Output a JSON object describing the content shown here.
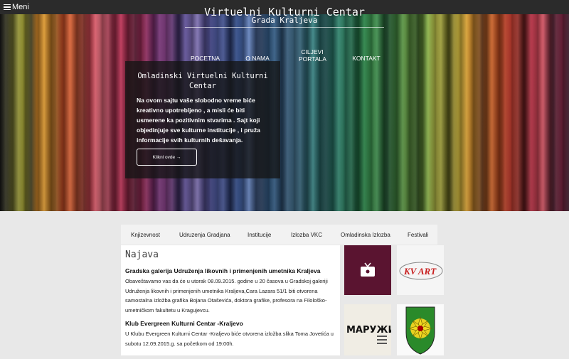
{
  "topbar": {
    "menu_label": "Meni"
  },
  "header": {
    "title": "Virtuelni Kulturni Centar",
    "subtitle": "Grada Kraljeva"
  },
  "nav": {
    "items": [
      {
        "label": "POCETNA"
      },
      {
        "label": "O NAMA"
      },
      {
        "label": "CILJEVI PORTALA"
      },
      {
        "label": "KONTAKT"
      }
    ]
  },
  "hero_panel": {
    "heading": "Omladinski Virtuelni Kulturni Centar",
    "text": "Na ovom sajtu vaše slobodno vreme biće kreativno upotrebljeno , a misli će biti usmerene ka pozitivnim stvarima . Sajt koji objedinjuje sve kulturne institucije , i pruža informacije svih kulturnih dešavanja.",
    "button_label": "Kliknl ovde →"
  },
  "tabs": [
    {
      "label": "Knjizevnost"
    },
    {
      "label": "Udruzenja Gradjana"
    },
    {
      "label": "Institucije"
    },
    {
      "label": "Izlozba VKC"
    },
    {
      "label": "Omladinska Izlozba"
    },
    {
      "label": "Festivali"
    }
  ],
  "news": {
    "heading": "Najava",
    "articles": [
      {
        "title": "Gradska galerija Udruženja likovnih i primenjenih umetnika Kraljeva",
        "body": "Obaveštavamo vas da će u utorak 08.09.2015. godine u 20 časova u Gradskoj galeriji Udruženja likovnih i primenjenih umetnika Kraljeva,Cara Lazara 51/1 biti otvorena samostalna izložba grafika Bojana Otaševića, doktora grafike, profesora na Filološko-umetničkom fakultetu u Kragujevcu."
      },
      {
        "title": "Klub Evergreen Kulturni Centar -Kraljevo",
        "body": "U Klubu Evergreen Kulturni Centar -Kraljevo biće otvorena izložba slika Toma Jovetića u subotu 12.09.2015.g. sa početkom od 19:00h."
      }
    ]
  },
  "thumbnails": {
    "kvart_text": "KV ART",
    "maruzik_text": "МАРУЖИК"
  },
  "colors": {
    "topbar": "#2b2b2b",
    "page_bg": "#e8e8e8",
    "thumb_maroon": "#5a1430"
  }
}
